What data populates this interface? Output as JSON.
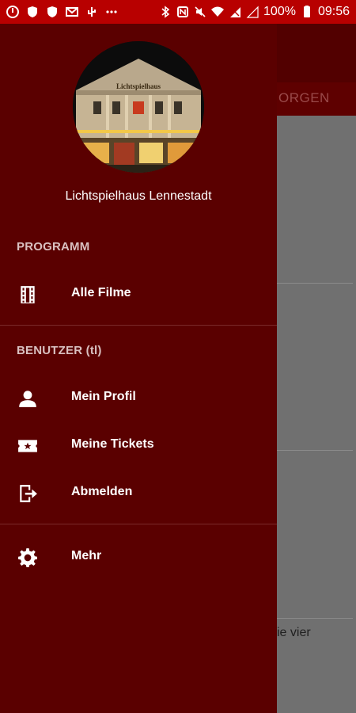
{
  "status_bar": {
    "battery_text": "100%",
    "time": "09:56",
    "icons": [
      "power-icon",
      "shield-icon",
      "shield-icon",
      "mail-icon",
      "usb-icon",
      "more-icon",
      "bluetooth-icon",
      "nfc-icon",
      "mute-icon",
      "wifi-icon",
      "no-sim-icon",
      "signal-icon",
      "battery-icon"
    ]
  },
  "background_app": {
    "tab_partial_label": "ORGEN",
    "content_partial_text": "ie vier"
  },
  "drawer": {
    "cinema_name": "Lichtspielhaus Lennestadt",
    "avatar_sign_text": "Lichtspielhaus",
    "sections": [
      {
        "header": "PROGRAMM",
        "items": [
          {
            "label": "Alle Filme",
            "icon": "film-icon"
          }
        ]
      },
      {
        "header": "BENUTZER (tl)",
        "items": [
          {
            "label": "Mein Profil",
            "icon": "person-icon"
          },
          {
            "label": "Meine Tickets",
            "icon": "ticket-icon"
          },
          {
            "label": "Abmelden",
            "icon": "logout-icon"
          }
        ]
      },
      {
        "header": "",
        "items": [
          {
            "label": "Mehr",
            "icon": "gear-icon"
          }
        ]
      }
    ]
  },
  "colors": {
    "status_bar": "#b80000",
    "drawer_background": "#5a0000",
    "section_header_text": "#d9c0c0",
    "scrim": "#707070"
  }
}
